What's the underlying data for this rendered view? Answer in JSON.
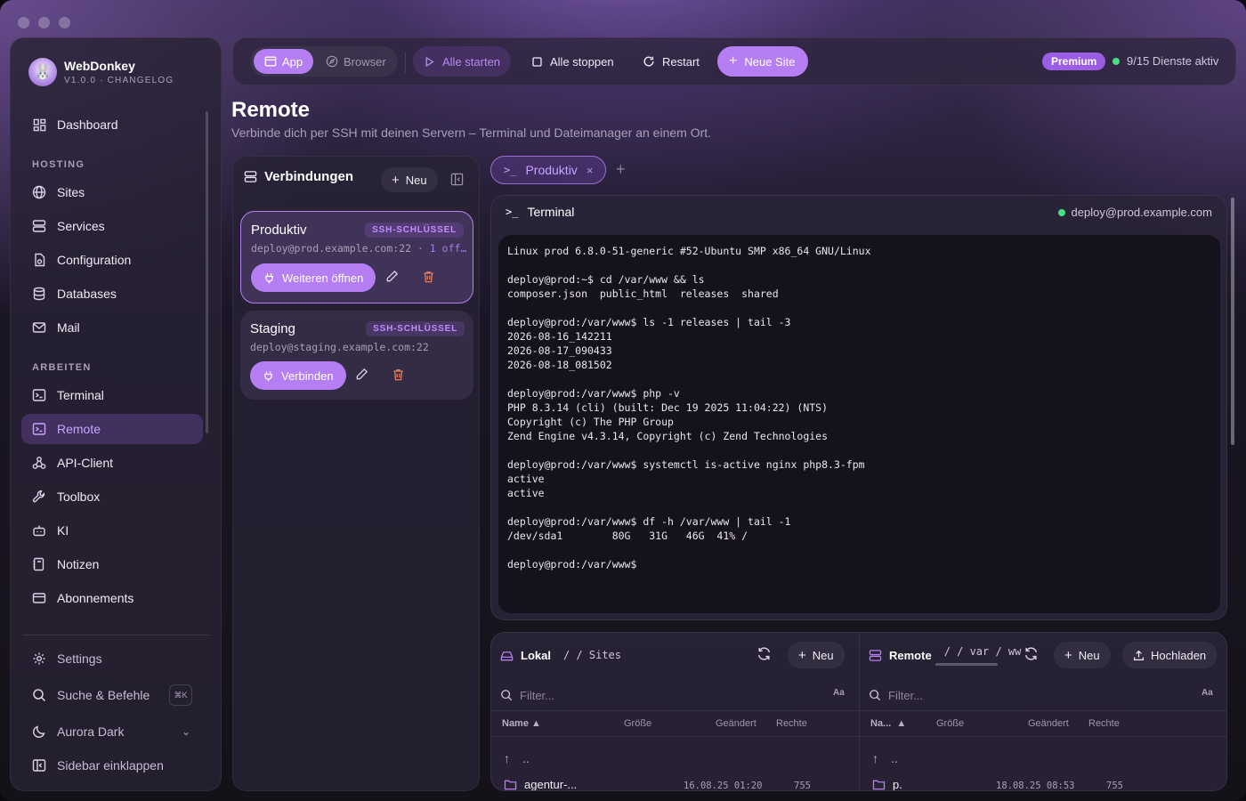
{
  "app": {
    "name": "WebDonkey",
    "version": "V1.0.0 · CHANGELOG"
  },
  "sidebar": {
    "items_top": [
      {
        "label": "Dashboard",
        "icon": "dashboard-icon"
      }
    ],
    "section_hosting": "HOSTING",
    "hosting_items": [
      {
        "label": "Sites",
        "icon": "globe-icon"
      },
      {
        "label": "Services",
        "icon": "server-icon"
      },
      {
        "label": "Configuration",
        "icon": "file-gear-icon"
      },
      {
        "label": "Databases",
        "icon": "database-icon"
      },
      {
        "label": "Mail",
        "icon": "mail-icon"
      }
    ],
    "section_work": "ARBEITEN",
    "work_items": [
      {
        "label": "Terminal",
        "icon": "terminal-icon"
      },
      {
        "label": "Remote",
        "icon": "remote-terminal-icon",
        "active": true
      },
      {
        "label": "API-Client",
        "icon": "webhook-icon"
      },
      {
        "label": "Toolbox",
        "icon": "wrench-icon"
      },
      {
        "label": "KI",
        "icon": "bot-icon"
      },
      {
        "label": "Notizen",
        "icon": "notebook-icon"
      },
      {
        "label": "Abonnements",
        "icon": "credit-card-icon"
      }
    ],
    "bottom": {
      "settings": "Settings",
      "search": "Suche & Befehle",
      "search_kbd": "⌘K",
      "theme": "Aurora Dark",
      "collapse": "Sidebar einklappen"
    }
  },
  "topbar": {
    "mode_app": "App",
    "mode_browser": "Browser",
    "start_all": "Alle starten",
    "stop_all": "Alle stoppen",
    "restart": "Restart",
    "new_site": "Neue Site",
    "premium": "Premium",
    "services_status": "9/15 Dienste aktiv"
  },
  "page": {
    "title": "Remote",
    "subtitle": "Verbinde dich per SSH mit deinen Servern – Terminal und Dateimanager an einem Ort."
  },
  "connections": {
    "title": "Verbindungen",
    "new_label": "Neu",
    "items": [
      {
        "name": "Produktiv",
        "tag": "SSH-SCHLÜSSEL",
        "host": "deploy@prod.example.com:22",
        "extra": "· 1 off…",
        "action": "Weiteren öffnen"
      },
      {
        "name": "Staging",
        "tag": "SSH-SCHLÜSSEL",
        "host": "deploy@staging.example.com:22",
        "extra": "",
        "action": "Verbinden"
      }
    ]
  },
  "tabs": [
    {
      "label": "Produktiv"
    }
  ],
  "terminal": {
    "title": "Terminal",
    "user": "deploy@prod.example.com",
    "output": "Linux prod 6.8.0-51-generic #52-Ubuntu SMP x86_64 GNU/Linux\n\ndeploy@prod:~$ cd /var/www && ls\ncomposer.json  public_html  releases  shared\n\ndeploy@prod:/var/www$ ls -1 releases | tail -3\n2026-08-16_142211\n2026-08-17_090433\n2026-08-18_081502\n\ndeploy@prod:/var/www$ php -v\nPHP 8.3.14 (cli) (built: Dec 19 2025 11:04:22) (NTS)\nCopyright (c) The PHP Group\nZend Engine v4.3.14, Copyright (c) Zend Technologies\n\ndeploy@prod:/var/www$ systemctl is-active nginx php8.3-fpm\nactive\nactive\n\ndeploy@prod:/var/www$ df -h /var/www | tail -1\n/dev/sda1        80G   31G   46G  41% /\n\ndeploy@prod:/var/www$"
  },
  "files_local": {
    "title": "Lokal",
    "crumb": "/  /  Sites",
    "new_label": "Neu",
    "filter_placeholder": "Filter...",
    "aa": "Aa",
    "columns": {
      "name": "Name ▲",
      "size": "Größe",
      "changed": "Geändert",
      "perm": "Rechte"
    },
    "up": "..",
    "rows": [
      {
        "name": "agentur-...",
        "date": "16.08.25 01:20",
        "perm": "755"
      }
    ]
  },
  "files_remote": {
    "title": "Remote",
    "crumb": "/  /  var  /  ww",
    "new_label": "Neu",
    "upload_label": "Hochladen",
    "filter_placeholder": "Filter...",
    "aa": "Aa",
    "columns": {
      "name": "Na...  ▲",
      "size": "Größe",
      "changed": "Geändert",
      "perm": "Rechte"
    },
    "up": "..",
    "rows": [
      {
        "name": "p.",
        "date": "18.08.25 08:53",
        "perm": "755"
      }
    ]
  },
  "colors": {
    "accent": "#b57ef2",
    "accent_text": "#c9a3ff",
    "status_green": "#4ade80",
    "danger": "#f0825a"
  }
}
